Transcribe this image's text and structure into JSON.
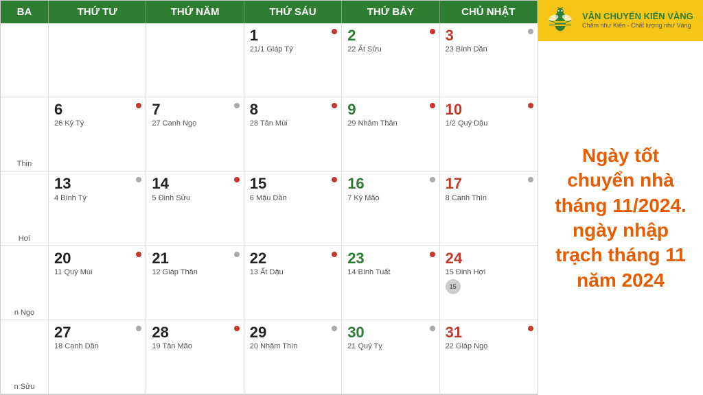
{
  "header": {
    "columns": [
      "BA",
      "THỨ TƯ",
      "THỨ NĂM",
      "THỨ SÁU",
      "THỨ BẢY",
      "CHỦ NHẬT"
    ]
  },
  "brand": {
    "name": "VẬN CHUYỂN KIẾN VÀNG",
    "tagline1": "Chăm như Kiến - Chất lượng như Vàng",
    "tagline2": ""
  },
  "promo": {
    "text": "Ngày tốt chuyển nhà tháng 11/2024. ngày nhập trạch tháng 11 năm 2024"
  },
  "rows": [
    {
      "side": "",
      "cells": [
        {
          "day": "1",
          "lunar": "21/1 Giáp Tý",
          "color": "normal",
          "dot": "red"
        },
        {
          "day": "2",
          "lunar": "22 Ất Sửu",
          "color": "green",
          "dot": "red"
        },
        {
          "day": "3",
          "lunar": "23 Bính Dần",
          "color": "red",
          "dot": "gray"
        }
      ],
      "emptyStart": true
    },
    {
      "side": "Thin",
      "cells": [
        {
          "day": "6",
          "lunar": "26 Kỷ Tý",
          "color": "normal",
          "dot": "red"
        },
        {
          "day": "7",
          "lunar": "27 Canh Ngọ",
          "color": "normal",
          "dot": "gray"
        },
        {
          "day": "8",
          "lunar": "28 Tân Mùi",
          "color": "normal",
          "dot": "red"
        },
        {
          "day": "9",
          "lunar": "29 Nhâm Thân",
          "color": "green",
          "dot": "red"
        },
        {
          "day": "10",
          "lunar": "1/2 Quý Dậu",
          "color": "red",
          "dot": "red"
        }
      ]
    },
    {
      "side": "Hơi",
      "cells": [
        {
          "day": "13",
          "lunar": "4 Bính Tý",
          "color": "normal",
          "dot": "gray"
        },
        {
          "day": "14",
          "lunar": "5 Đinh Sửu",
          "color": "normal",
          "dot": "red"
        },
        {
          "day": "15",
          "lunar": "6 Mậu Dần",
          "color": "normal",
          "dot": "red"
        },
        {
          "day": "16",
          "lunar": "7 Kỷ Mão",
          "color": "green",
          "dot": "gray"
        },
        {
          "day": "17",
          "lunar": "8 Canh Thìn",
          "color": "red",
          "dot": "gray"
        }
      ]
    },
    {
      "side": "n Ngọ",
      "cells": [
        {
          "day": "20",
          "lunar": "11 Quý Mùi",
          "color": "normal",
          "dot": "red"
        },
        {
          "day": "21",
          "lunar": "12 Giáp Thân",
          "color": "normal",
          "dot": "gray"
        },
        {
          "day": "22",
          "lunar": "13 Ất Dậu",
          "color": "normal",
          "dot": "red"
        },
        {
          "day": "23",
          "lunar": "14 Bính Tuất",
          "color": "green",
          "dot": "red"
        },
        {
          "day": "24",
          "lunar": "15 Đinh Hợi",
          "color": "red",
          "dot": "lunar"
        }
      ]
    },
    {
      "side": "n Sửu",
      "cells": [
        {
          "day": "27",
          "lunar": "18 Canh Dần",
          "color": "normal",
          "dot": "gray"
        },
        {
          "day": "28",
          "lunar": "19 Tân Mão",
          "color": "normal",
          "dot": "red"
        },
        {
          "day": "29",
          "lunar": "20 Nhâm Thìn",
          "color": "normal",
          "dot": "gray"
        },
        {
          "day": "30",
          "lunar": "21 Quý Tỵ",
          "color": "green",
          "dot": "gray"
        },
        {
          "day": "31",
          "lunar": "22 Giáp Ngọ",
          "color": "red",
          "dot": "red"
        }
      ]
    }
  ]
}
